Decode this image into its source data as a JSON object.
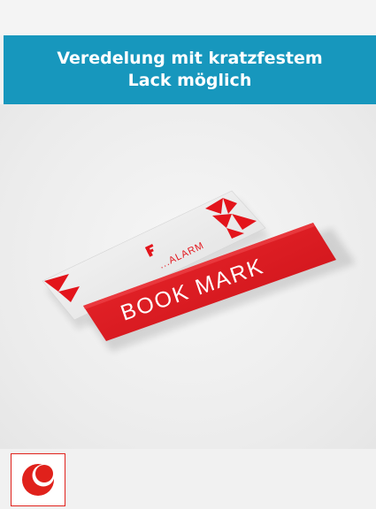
{
  "banner": {
    "title": "Veredelung mit kratzfestem Lack möglich"
  },
  "product_image": {
    "back_card_text": "...ALARM",
    "front_card_text": "BOOK MARK"
  },
  "logo": {
    "icon": "crescent-moon-icon"
  },
  "colors": {
    "banner": "#1797bd",
    "brand_red": "#e0211b",
    "card_red": "#e3141b"
  }
}
